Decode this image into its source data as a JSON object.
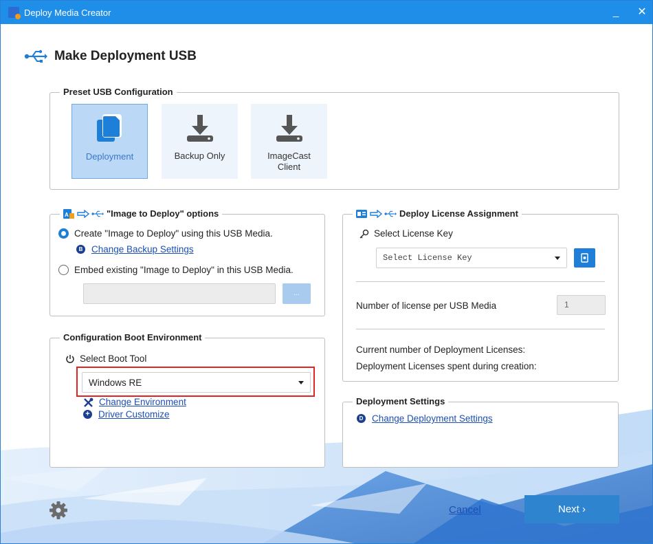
{
  "window": {
    "title": "Deploy Media Creator",
    "minimize": "_",
    "close": "✕"
  },
  "header": {
    "title": "Make Deployment USB"
  },
  "preset": {
    "legend": "Preset USB Configuration",
    "tiles": [
      {
        "label": "Deployment",
        "selected": true
      },
      {
        "label": "Backup Only",
        "selected": false
      },
      {
        "label": "ImageCast Client",
        "selected": false
      }
    ]
  },
  "image_to_deploy": {
    "legend": "\"Image to Deploy\" options",
    "option_create": "Create \"Image to Deploy\" using this USB Media.",
    "change_backup_link": "Change Backup Settings",
    "backup_badge": "B",
    "option_embed": "Embed existing \"Image to Deploy\" in this USB Media.",
    "path_value": "",
    "browse_label": "..."
  },
  "license": {
    "legend": "Deploy License Assignment",
    "select_key_label": "Select License Key",
    "select_key_placeholder": "Select License Key",
    "per_media_label": "Number of license per USB Media",
    "per_media_value": "1",
    "current_label": "Current number of Deployment Licenses:",
    "spent_label": "Deployment Licenses spent during creation:"
  },
  "boot": {
    "legend": "Configuration Boot Environment",
    "select_tool_label": "Select Boot Tool",
    "selected_tool": "Windows RE",
    "change_env_link": "Change Environment",
    "driver_link": "Driver Customize"
  },
  "deploy_settings": {
    "legend": "Deployment Settings",
    "badge": "D",
    "change_link": "Change Deployment Settings"
  },
  "footer": {
    "cancel_label": "Cancel",
    "next_label": "Next ›"
  },
  "colors": {
    "titlebar": "#1e8ee8",
    "accent": "#1e7fd8",
    "link": "#1b4fb5",
    "highlight": "#e02424"
  }
}
